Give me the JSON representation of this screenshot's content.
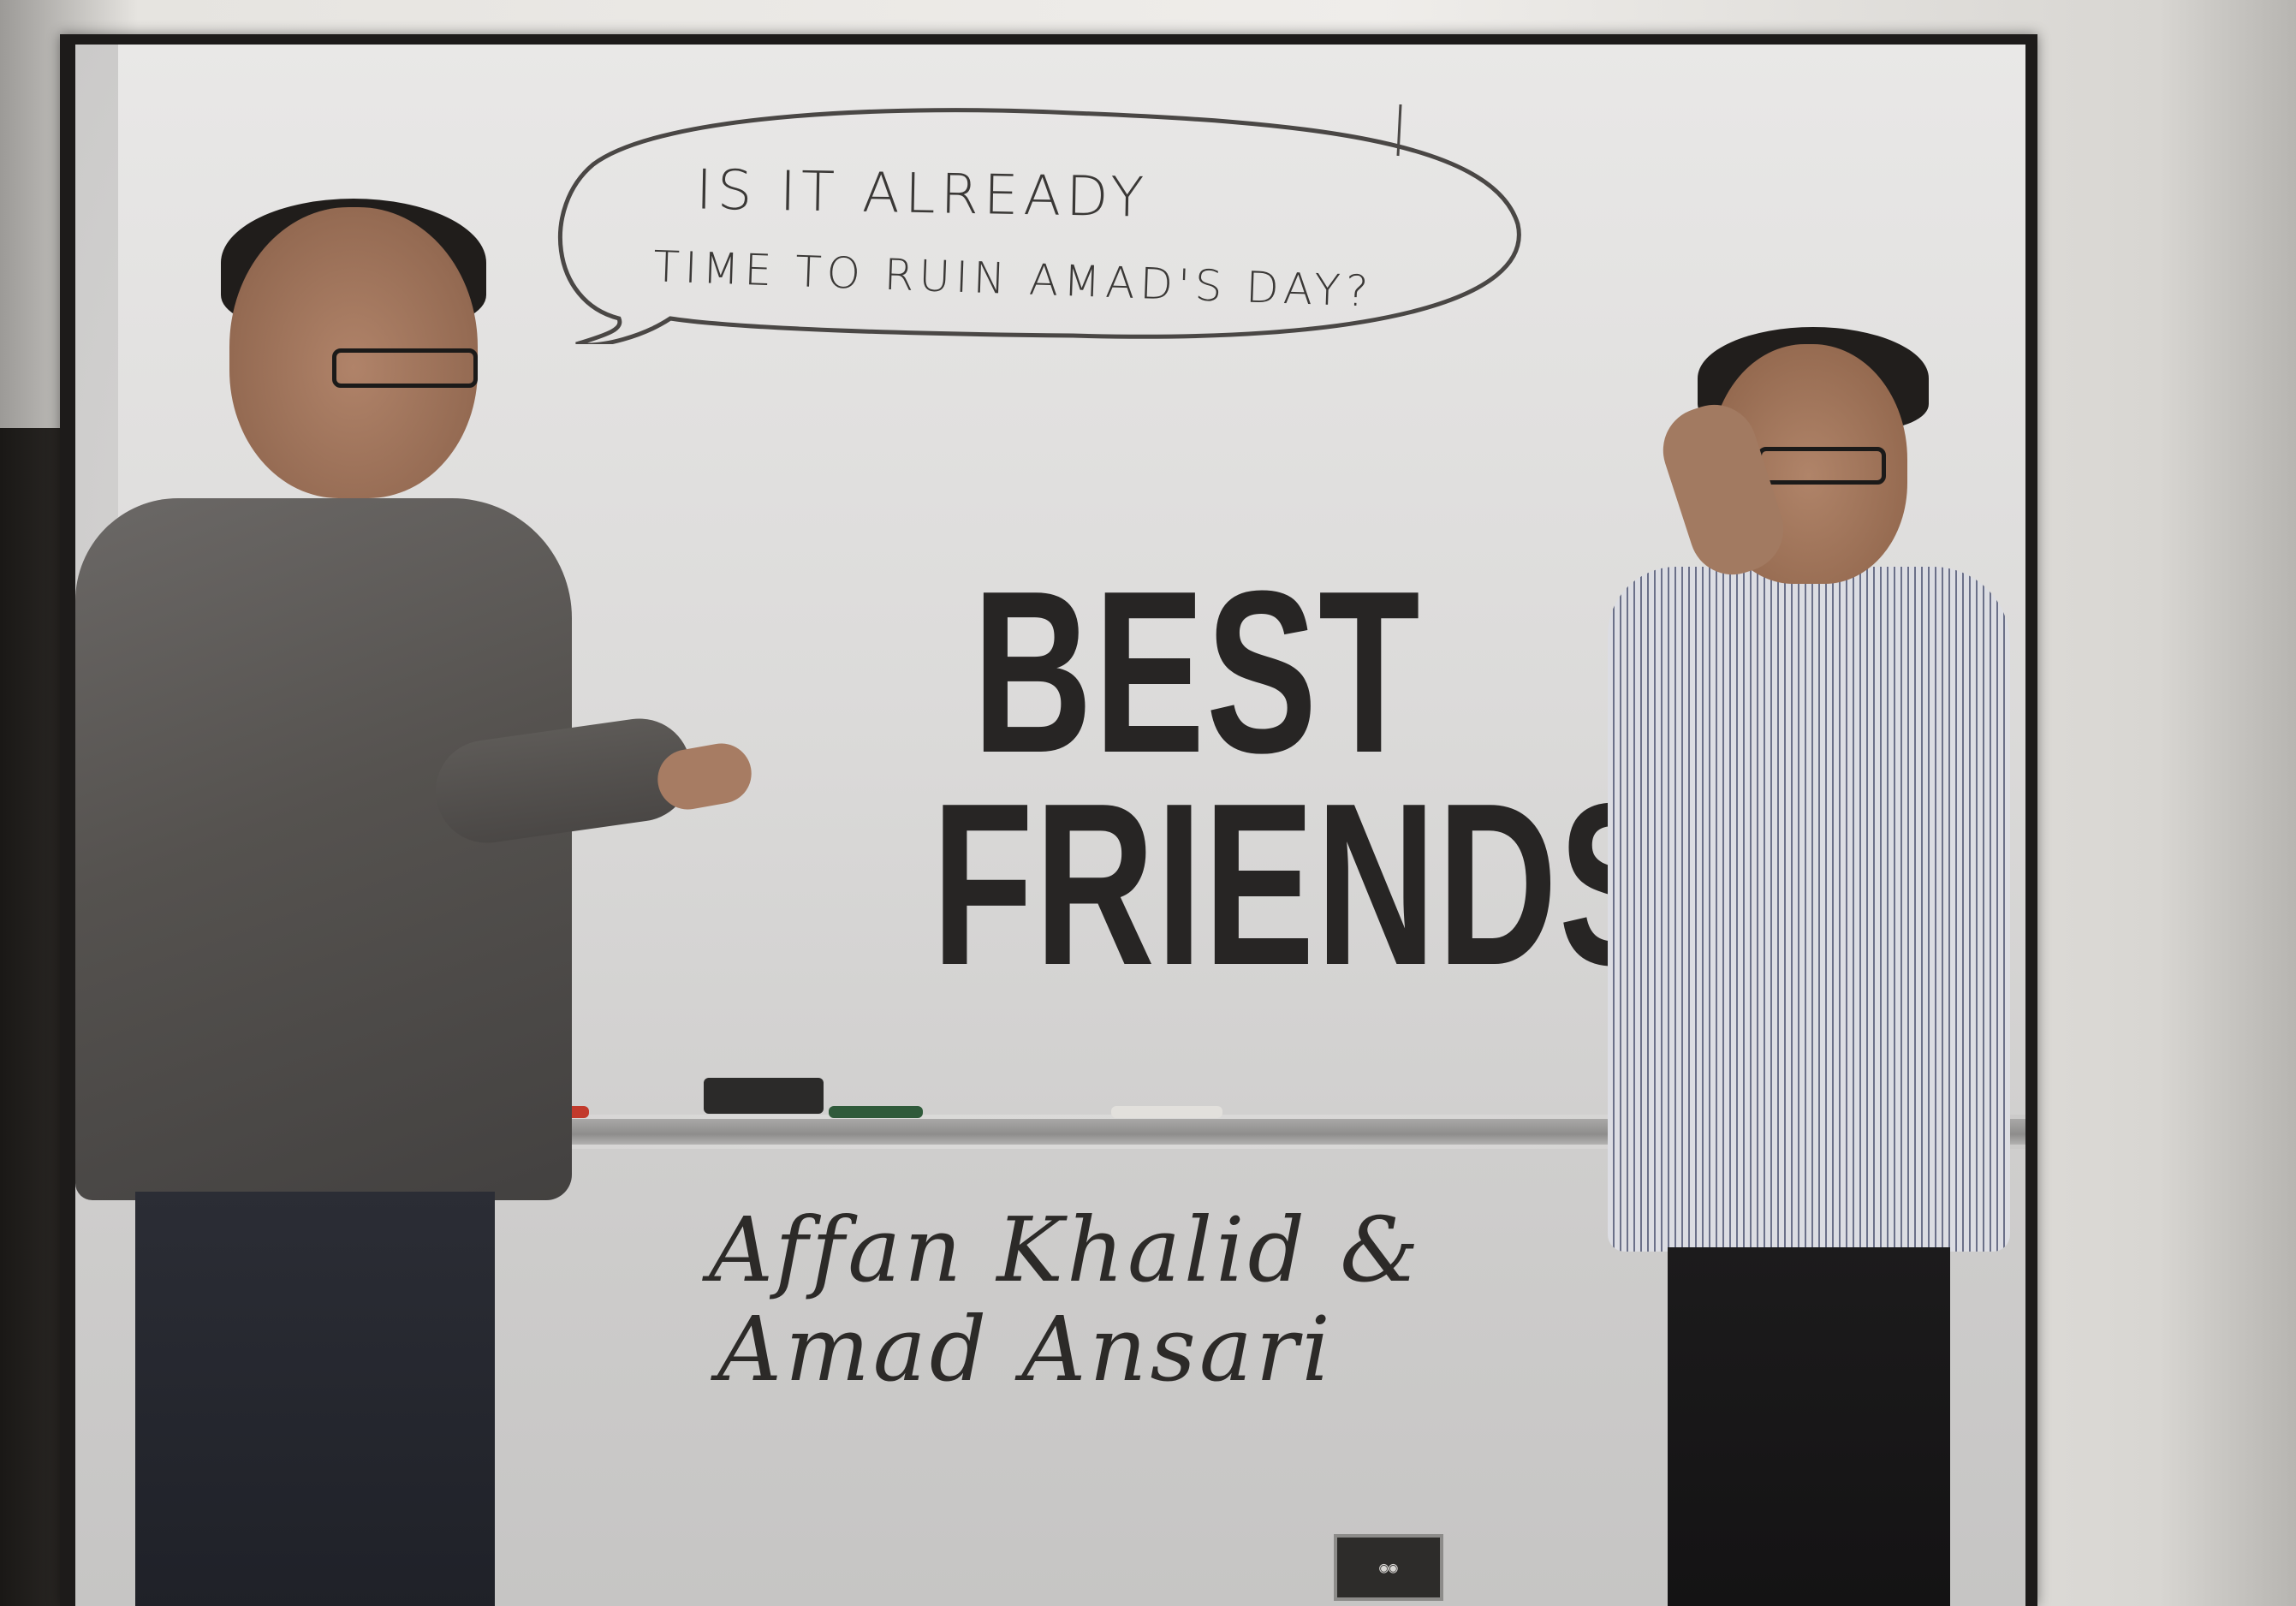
{
  "speech_bubble": {
    "line1": "IS IT ALREADY",
    "line2": "TIME TO RUIN AMAD'S DAY?"
  },
  "headline": {
    "line1": "BEST",
    "line2": "FRIENDS"
  },
  "names": {
    "line1": "Affan Khalid &",
    "line2": "Amad Ansari"
  },
  "colors": {
    "frame": "#1d1b1a",
    "whiteboard": "#e4e3e2",
    "ink": "#272524"
  }
}
